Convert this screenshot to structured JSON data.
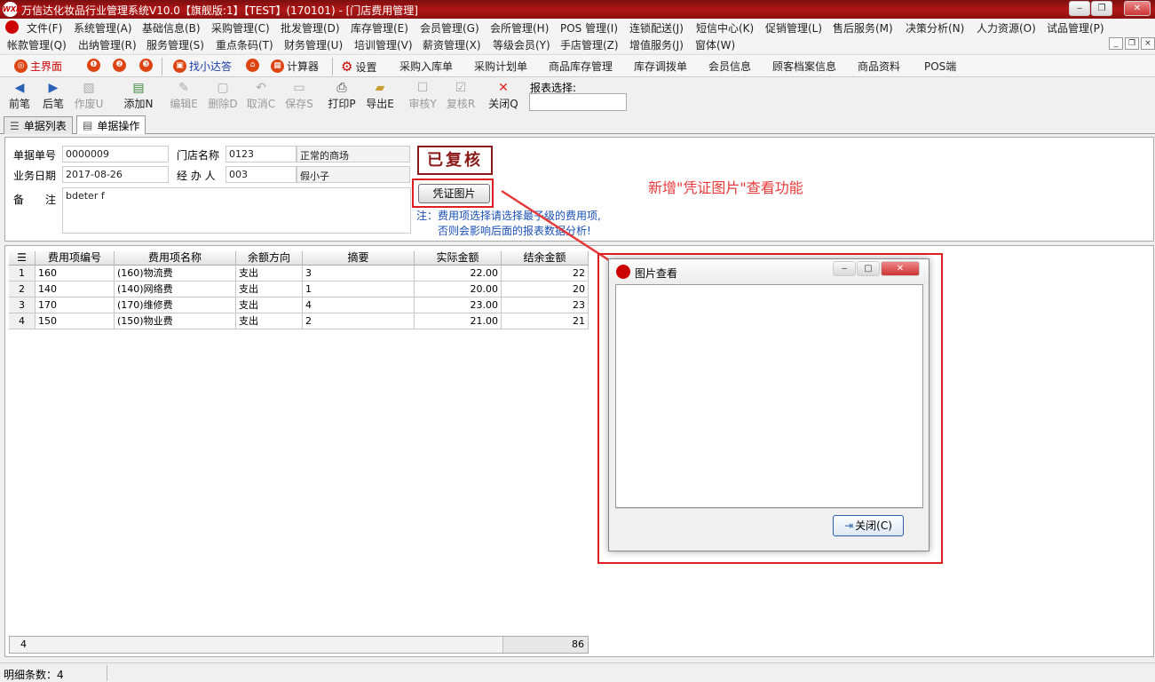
{
  "window": {
    "title": "万信达化妆品行业管理系统V10.0【旗舰版:1】【TEST】(170101) - [门店费用管理]",
    "logo_text": "WXD",
    "min": "‒",
    "restore": "❐",
    "close": "✕"
  },
  "menu_row1": [
    "文件(F)",
    "系统管理(A)",
    "基础信息(B)",
    "采购管理(C)",
    "批发管理(D)",
    "库存管理(E)",
    "会员管理(G)",
    "会所管理(H)",
    "POS 管理(I)",
    "连锁配送(J)",
    "短信中心(K)",
    "促销管理(L)",
    "售后服务(M)",
    "决策分析(N)",
    "人力资源(O)",
    "试品管理(P)"
  ],
  "menu_row2": [
    "帐款管理(Q)",
    "出纳管理(R)",
    "服务管理(S)",
    "重点条码(T)",
    "财务管理(U)",
    "培训管理(V)",
    "薪资管理(X)",
    "等级会员(Y)",
    "手店管理(Z)",
    "增值服务(J)",
    "窗体(W)"
  ],
  "quickbar": {
    "home": "主界面",
    "icon1": "❶",
    "icon2": "❷",
    "icon3": "❸",
    "find_xd": "找小达答",
    "home2_icon": "⌂",
    "calculator": "计算器",
    "settings": "设置",
    "links": [
      "采购入库单",
      "采购计划单",
      "商品库存管理",
      "库存调拨单",
      "会员信息",
      "顾客档案信息",
      "商品资料",
      "POS端"
    ]
  },
  "toolbar": {
    "prev": "前笔",
    "next": "后笔",
    "void": "作废U",
    "add": "添加N",
    "edit": "编辑E",
    "delete": "删除D",
    "cancel": "取消C",
    "save": "保存S",
    "print": "打印P",
    "export": "导出E",
    "audit": "审核Y",
    "reaudit": "复核R",
    "close": "关闭Q",
    "report_label": "报表选择:"
  },
  "tabs": {
    "list": "单据列表",
    "operate": "单据操作"
  },
  "form": {
    "doc_no_label": "单据单号",
    "doc_no": "0000009",
    "store_label": "门店名称",
    "store_code": "0123",
    "store_name": "正常的商场",
    "date_label": "业务日期",
    "date": "2017-08-26",
    "handler_label": "经 办 人",
    "handler_code": "003",
    "handler_name": "假小子",
    "remark_label1": "备",
    "remark_label2": "注",
    "remark": "bdeter f",
    "stamp": "已复核",
    "voucher_btn": "凭证图片",
    "note_line1": "注：费用项选择请选择最子级的费用项,",
    "note_line2": "否则会影响后面的报表数据分析!"
  },
  "annotation": "新增\"凭证图片\"查看功能",
  "grid": {
    "headers": [
      "费用项编号",
      "费用项名称",
      "余额方向",
      "摘要",
      "实际金额",
      "结余金额"
    ],
    "rows": [
      {
        "n": "1",
        "code": "160",
        "name": "(160)物流费",
        "dir": "支出",
        "memo": "3",
        "amount": "22.00",
        "balance": "22"
      },
      {
        "n": "2",
        "code": "140",
        "name": "(140)网络费",
        "dir": "支出",
        "memo": "1",
        "amount": "20.00",
        "balance": "20"
      },
      {
        "n": "3",
        "code": "170",
        "name": "(170)维修费",
        "dir": "支出",
        "memo": "4",
        "amount": "23.00",
        "balance": "23"
      },
      {
        "n": "4",
        "code": "150",
        "name": "(150)物业费",
        "dir": "支出",
        "memo": "2",
        "amount": "21.00",
        "balance": "21"
      }
    ],
    "footer_count": "4",
    "footer_total": "86"
  },
  "status": {
    "detail_count": "明细条数：4"
  },
  "picture_viewer": {
    "title": "图片查看",
    "close_btn": "关闭(C)"
  },
  "colors": {
    "title_red": "#b11616",
    "annotation_red": "#e83a3a",
    "note_blue": "#1a4fb5",
    "stamp": "#8b1a1a"
  }
}
